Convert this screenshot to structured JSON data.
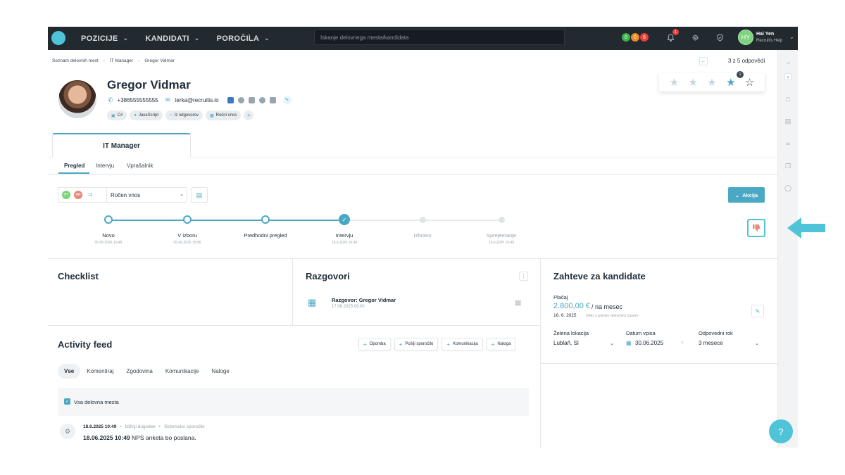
{
  "topbar": {
    "nav": [
      "POZICIJE",
      "KANDIDATI",
      "POROČILA"
    ],
    "search_placeholder": "Iskanje delovnega mesta/kandidata",
    "pills": [
      {
        "label": "0",
        "color": "#3bb54a"
      },
      {
        "label": "0",
        "color": "#f08a24"
      },
      {
        "label": "6",
        "color": "#e8413a"
      }
    ],
    "bell_count": "1",
    "user_initials": "HY",
    "user_name": "Hai Yen",
    "user_org": "Recruitis Help"
  },
  "breadcrumb": [
    "Seznam delovnih mest",
    "IT Manager",
    "Gregor Vidmar"
  ],
  "pager_text": "3 z 5 odpovědí",
  "candidate": {
    "name": "Gregor Vidmar",
    "phone": "+386555555555",
    "email": "terka@recruitis.io",
    "tags": [
      {
        "icon": "monitor-icon",
        "label": "C#"
      },
      {
        "icon": "person-icon",
        "label": "JavaScript"
      },
      {
        "icon": "circle-icon",
        "label": "Iz odgovorov"
      },
      {
        "icon": "lock-icon",
        "label": "Ročni vnos"
      }
    ]
  },
  "rating": {
    "value": 4,
    "max": 5,
    "badge": "1"
  },
  "job_tab": "IT Manager",
  "subtabs": [
    "Pregled",
    "Intervju",
    "Vprašalnik"
  ],
  "pipeline": {
    "avatars": [
      {
        "initials": "HY",
        "color": "#7bd37b"
      },
      {
        "initials": "AN",
        "color": "#e8867a"
      }
    ],
    "source_select": "Ročen vnos",
    "action_label": "Akcija",
    "stages": [
      {
        "name": "Novo",
        "date": "05.06.2025 10:48",
        "state": "passed"
      },
      {
        "name": "V izboru",
        "date": "05.06.2025 10:56",
        "state": "passed"
      },
      {
        "name": "Predhodni pregled",
        "date": "",
        "state": "passed"
      },
      {
        "name": "Intervju",
        "date": "16.6.2025 10:34",
        "state": "current"
      },
      {
        "name": "Izbrano",
        "date": "",
        "state": "future"
      },
      {
        "name": "Sprejemanje",
        "date": "16.6.2025 10:49",
        "state": "future"
      }
    ]
  },
  "checklist": {
    "title": "Checklist"
  },
  "razgovori": {
    "title": "Razgovori",
    "item_title": "Razgovor: Gregor Vidmar",
    "item_date": "17.06.2025 09:00"
  },
  "requirements": {
    "title": "Zahteve za kandidate",
    "salary_label": "Plačaj",
    "salary_amount": "2.800,00 €",
    "salary_period": "/ na mesec",
    "date": "16. 6. 2025",
    "note": "Delo s polnim delovnim časom",
    "location_label": "Želena lokacija",
    "location_value": "Lublaň, SI",
    "start_label": "Datum vpisa",
    "start_value": "30.06.2025",
    "notice_label": "Odpovedni rok",
    "notice_value": "3 mesece"
  },
  "activity": {
    "title": "Activity feed",
    "buttons": [
      "Opomba",
      "Pošlji sporočilo",
      "Komunikacija",
      "Naloga"
    ],
    "filters": [
      "Vse",
      "Komentiraj",
      "Zgodovina",
      "Komunikacije",
      "Naloge"
    ],
    "all_positions": "Vsa delovna mesta",
    "event": {
      "time": "18.6.2025 10:49",
      "meta1": "bližnji dogodek",
      "meta2": "Sistemsko sporočilo",
      "time_bold": "18.06.2025 10:49",
      "text": "NPS anketa bo poslana."
    }
  },
  "help_label": "?"
}
